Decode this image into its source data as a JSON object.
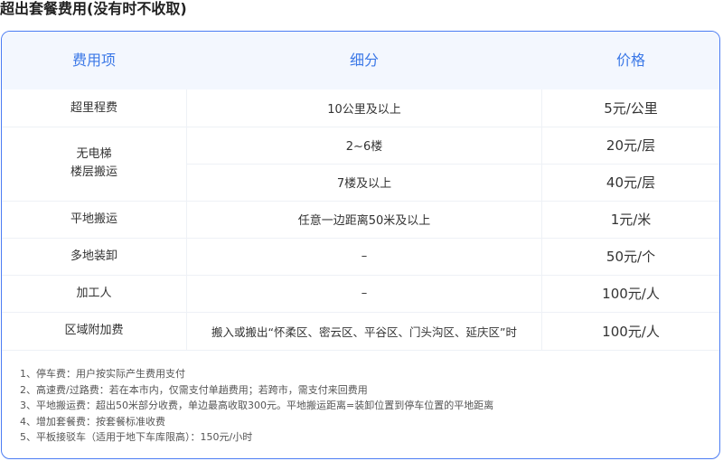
{
  "page_title": "超出套餐费用(没有时不收取)",
  "table": {
    "headers": [
      "费用项",
      "细分",
      "价格"
    ],
    "rows": [
      {
        "item": "超里程费",
        "detail": "10公里及以上",
        "price": "5元/公里"
      },
      {
        "item": "无电梯\n楼层搬运",
        "detail": "2~6楼",
        "price": "20元/层"
      },
      {
        "item": "",
        "detail": "7楼及以上",
        "price": "40元/层"
      },
      {
        "item": "平地搬运",
        "detail": "任意一边距离50米及以上",
        "price": "1元/米"
      },
      {
        "item": "多地装卸",
        "detail": "–",
        "price": "50元/个"
      },
      {
        "item": "加工人",
        "detail": "–",
        "price": "100元/人"
      },
      {
        "item": "区域附加费",
        "detail": "搬入或搬出“怀柔区、密云区、平谷区、门头沟区、延庆区”时",
        "price": "100元/人"
      }
    ]
  },
  "notes": [
    "1、停车费：用户按实际产生费用支付",
    "2、高速费/过路费：若在本市内，仅需支付单趟费用；若跨市，需支付来回费用",
    "3、平地搬运费：超出50米部分收费，单边最高收取300元。平地搬运距离=装卸位置到停车位置的平地距离",
    "4、增加套餐费：按套餐标准收费",
    "5、平板接驳车（适用于地下车库限高）：150元/小时"
  ],
  "colors": {
    "accent": "#3b78e7",
    "border": "#4b7cf3",
    "header_bg": "#f3f7fe"
  }
}
